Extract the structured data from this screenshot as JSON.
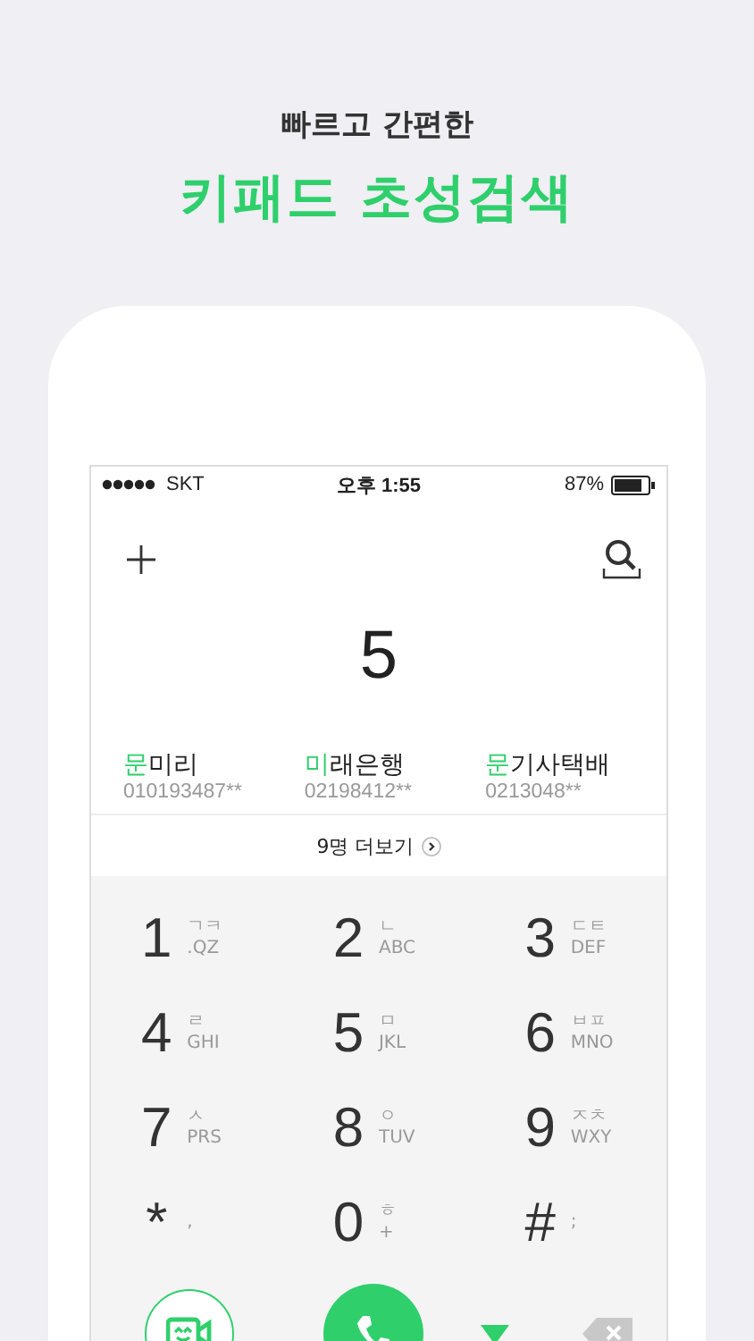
{
  "headline": {
    "subtitle": "빠르고 간편한",
    "title": "키패드 초성검색"
  },
  "status_bar": {
    "carrier": "SKT",
    "time": "오후 1:55",
    "battery": "87%"
  },
  "dialed": "5",
  "results": [
    {
      "match": "문",
      "rest": "미리",
      "number": "010193487**"
    },
    {
      "match": "미",
      "rest": "래은행",
      "number": "02198412**"
    },
    {
      "match": "문",
      "rest": "기사택배",
      "number": "0213048**"
    }
  ],
  "more": {
    "label": "9명 더보기"
  },
  "keypad": [
    {
      "digit": "1",
      "hangul": "ㄱㅋ",
      "letters": ".QZ"
    },
    {
      "digit": "2",
      "hangul": "ㄴ",
      "letters": "ABC"
    },
    {
      "digit": "3",
      "hangul": "ㄷㅌ",
      "letters": "DEF"
    },
    {
      "digit": "4",
      "hangul": "ㄹ",
      "letters": "GHI"
    },
    {
      "digit": "5",
      "hangul": "ㅁ",
      "letters": "JKL"
    },
    {
      "digit": "6",
      "hangul": "ㅂㅍ",
      "letters": "MNO"
    },
    {
      "digit": "7",
      "hangul": "ㅅ",
      "letters": "PRS"
    },
    {
      "digit": "8",
      "hangul": "ㅇ",
      "letters": "TUV"
    },
    {
      "digit": "9",
      "hangul": "ㅈㅊ",
      "letters": "WXY"
    },
    {
      "digit": "*",
      "letters": ","
    },
    {
      "digit": "0",
      "hangul": "ㅎ",
      "letters": "+"
    },
    {
      "digit": "#",
      "letters": ";"
    }
  ]
}
